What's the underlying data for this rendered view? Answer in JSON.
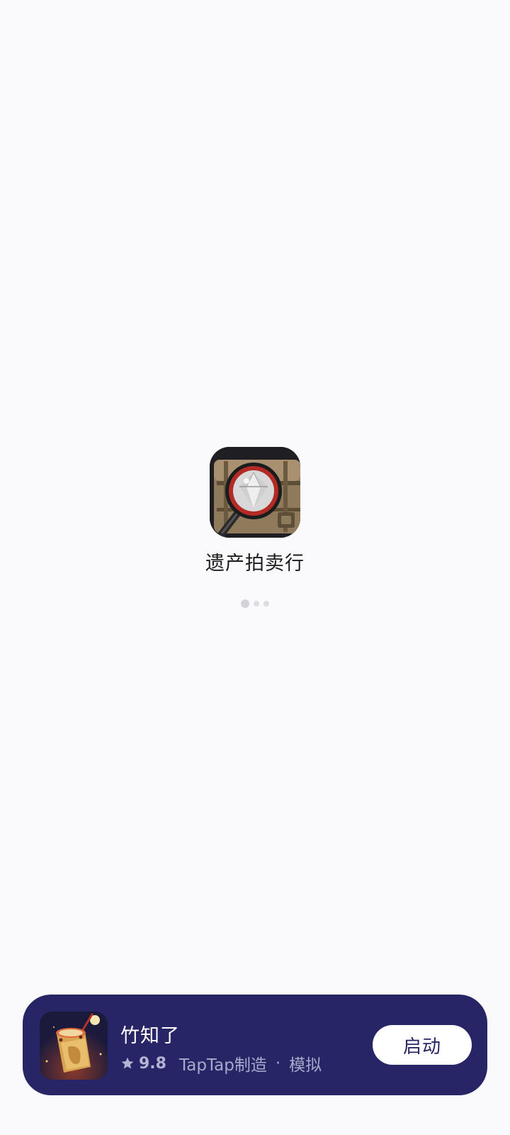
{
  "splash": {
    "app_icon": "treasure-chest-magnifier-diamond-icon",
    "app_name": "遗产拍卖行",
    "loading_dots": 3
  },
  "promo": {
    "icon": "bamboo-drum-game-icon",
    "title": "竹知了",
    "rating_icon": "star-icon",
    "rating": "9.8",
    "maker": "TapTap制造",
    "separator": "·",
    "genre": "模拟",
    "launch_label": "启动",
    "colors": {
      "card_background": "#272566",
      "button_background": "#ffffff",
      "muted_text": "#a9a9cc"
    }
  }
}
